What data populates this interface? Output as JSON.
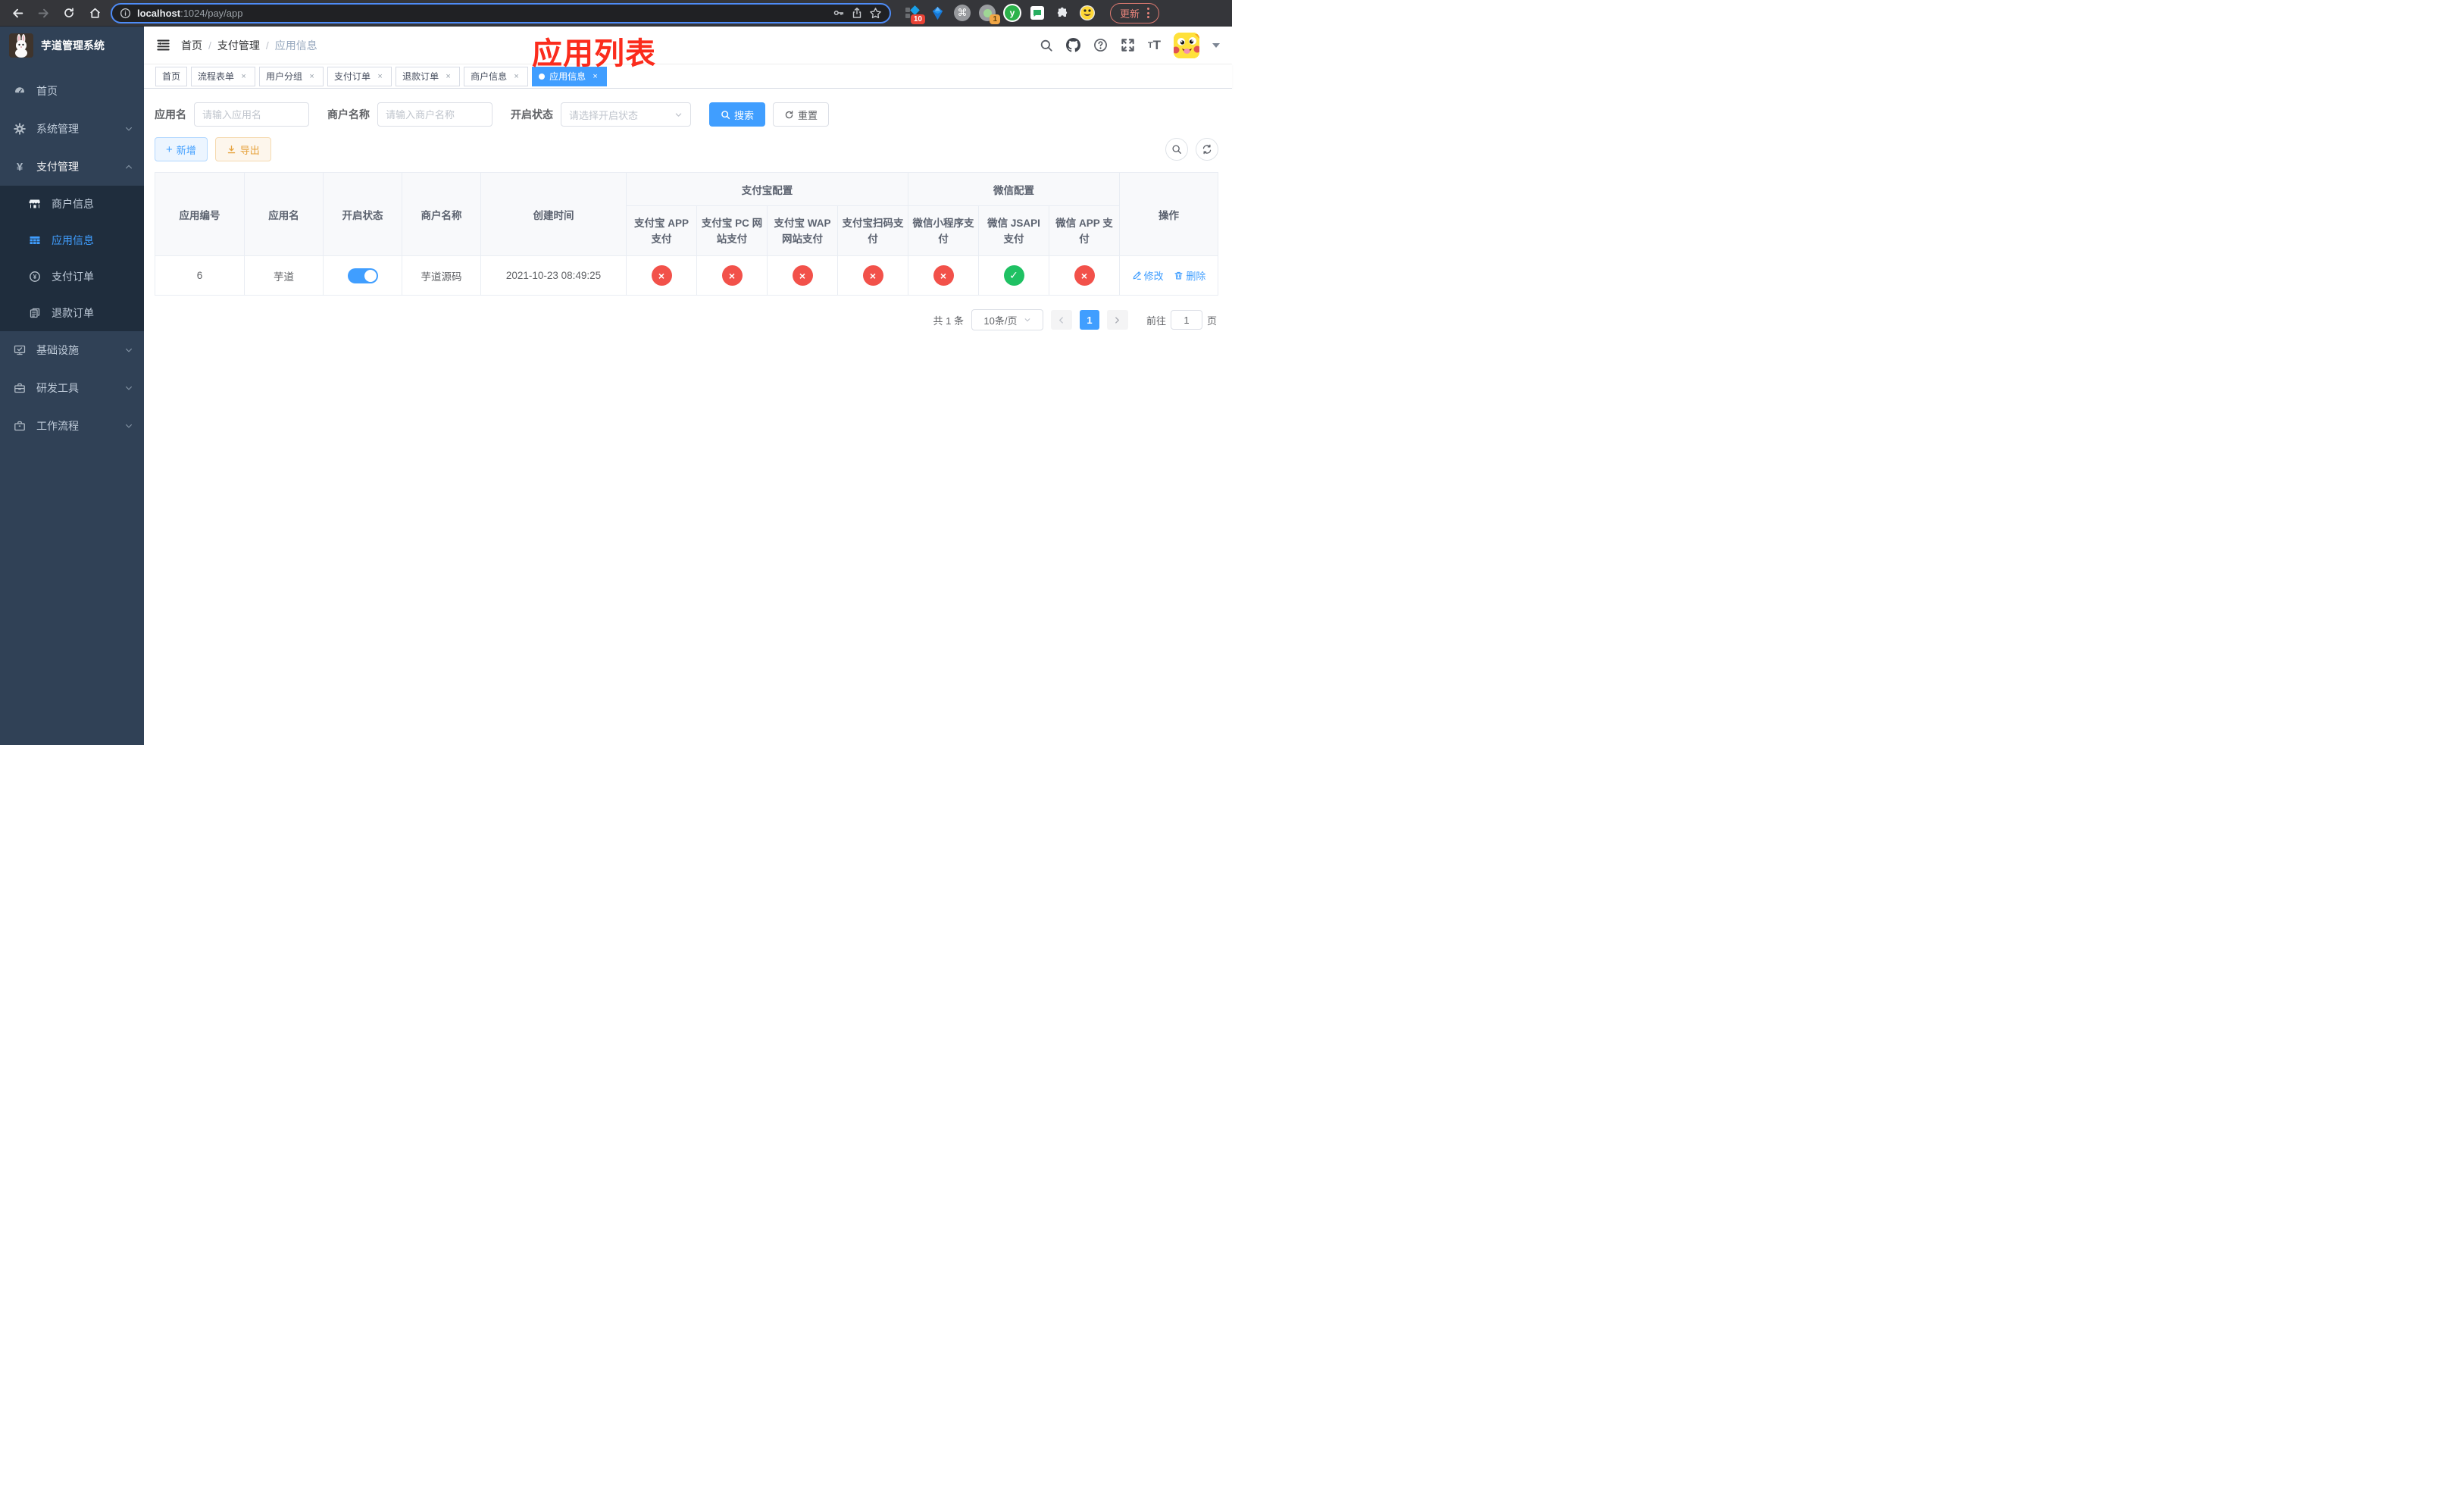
{
  "colors": {
    "accent": "#409eff",
    "danger": "#f2514a",
    "success": "#1fc163",
    "warning": "#e6a23c",
    "annotation_red": "#fb2c1d",
    "sidebar_bg": "#304156",
    "submenu_bg": "#1f2d3d"
  },
  "browser": {
    "url_host": "localhost",
    "url_rest": ":1024/pay/app",
    "update_button": "更新",
    "extension_badge_count": "10",
    "extension_badge_proxy": "1",
    "extension_letter": "y"
  },
  "sidebar": {
    "logo_title": "芋道管理系统",
    "items": [
      {
        "label": "首页"
      },
      {
        "label": "系统管理"
      },
      {
        "label": "支付管理"
      },
      {
        "label": "基础设施"
      },
      {
        "label": "研发工具"
      },
      {
        "label": "工作流程"
      }
    ],
    "submenu": [
      {
        "label": "商户信息"
      },
      {
        "label": "应用信息"
      },
      {
        "label": "支付订单"
      },
      {
        "label": "退款订单"
      }
    ]
  },
  "header": {
    "breadcrumb": [
      "首页",
      "支付管理",
      "应用信息"
    ],
    "annotation": "应用列表"
  },
  "tabs": [
    {
      "label": "首页"
    },
    {
      "label": "流程表单"
    },
    {
      "label": "用户分组"
    },
    {
      "label": "支付订单"
    },
    {
      "label": "退款订单"
    },
    {
      "label": "商户信息"
    },
    {
      "label": "应用信息"
    }
  ],
  "filters": {
    "app_name": {
      "label": "应用名",
      "placeholder": "请输入应用名"
    },
    "merchant_name": {
      "label": "商户名称",
      "placeholder": "请输入商户名称"
    },
    "status": {
      "label": "开启状态",
      "placeholder": "请选择开启状态"
    },
    "search": "搜索",
    "reset": "重置"
  },
  "toolbar": {
    "add": "新增",
    "export": "导出"
  },
  "table": {
    "headers": {
      "app_id": "应用编号",
      "app_name": "应用名",
      "status": "开启状态",
      "merchant": "商户名称",
      "created": "创建时间",
      "alipay_group": "支付宝配置",
      "wechat_group": "微信配置",
      "actions": "操作",
      "alipay_app": "支付宝 APP 支付",
      "alipay_pc": "支付宝 PC 网站支付",
      "alipay_wap": "支付宝 WAP 网站支付",
      "alipay_qr": "支付宝扫码支付",
      "wx_lite": "微信小程序支付",
      "wx_jsapi": "微信 JSAPI 支付",
      "wx_app": "微信 APP 支付"
    },
    "row": {
      "app_id": "6",
      "app_name": "芋道",
      "status_on": true,
      "merchant": "芋道源码",
      "created": "2021-10-23 08:49:25",
      "statuses": [
        "fail",
        "fail",
        "fail",
        "fail",
        "fail",
        "success",
        "fail"
      ],
      "edit": "修改",
      "delete": "删除"
    }
  },
  "pagination": {
    "total": "共 1 条",
    "page_size": "10条/页",
    "page": "1",
    "goto_label": "前往",
    "goto_value": "1",
    "goto_unit": "页"
  }
}
